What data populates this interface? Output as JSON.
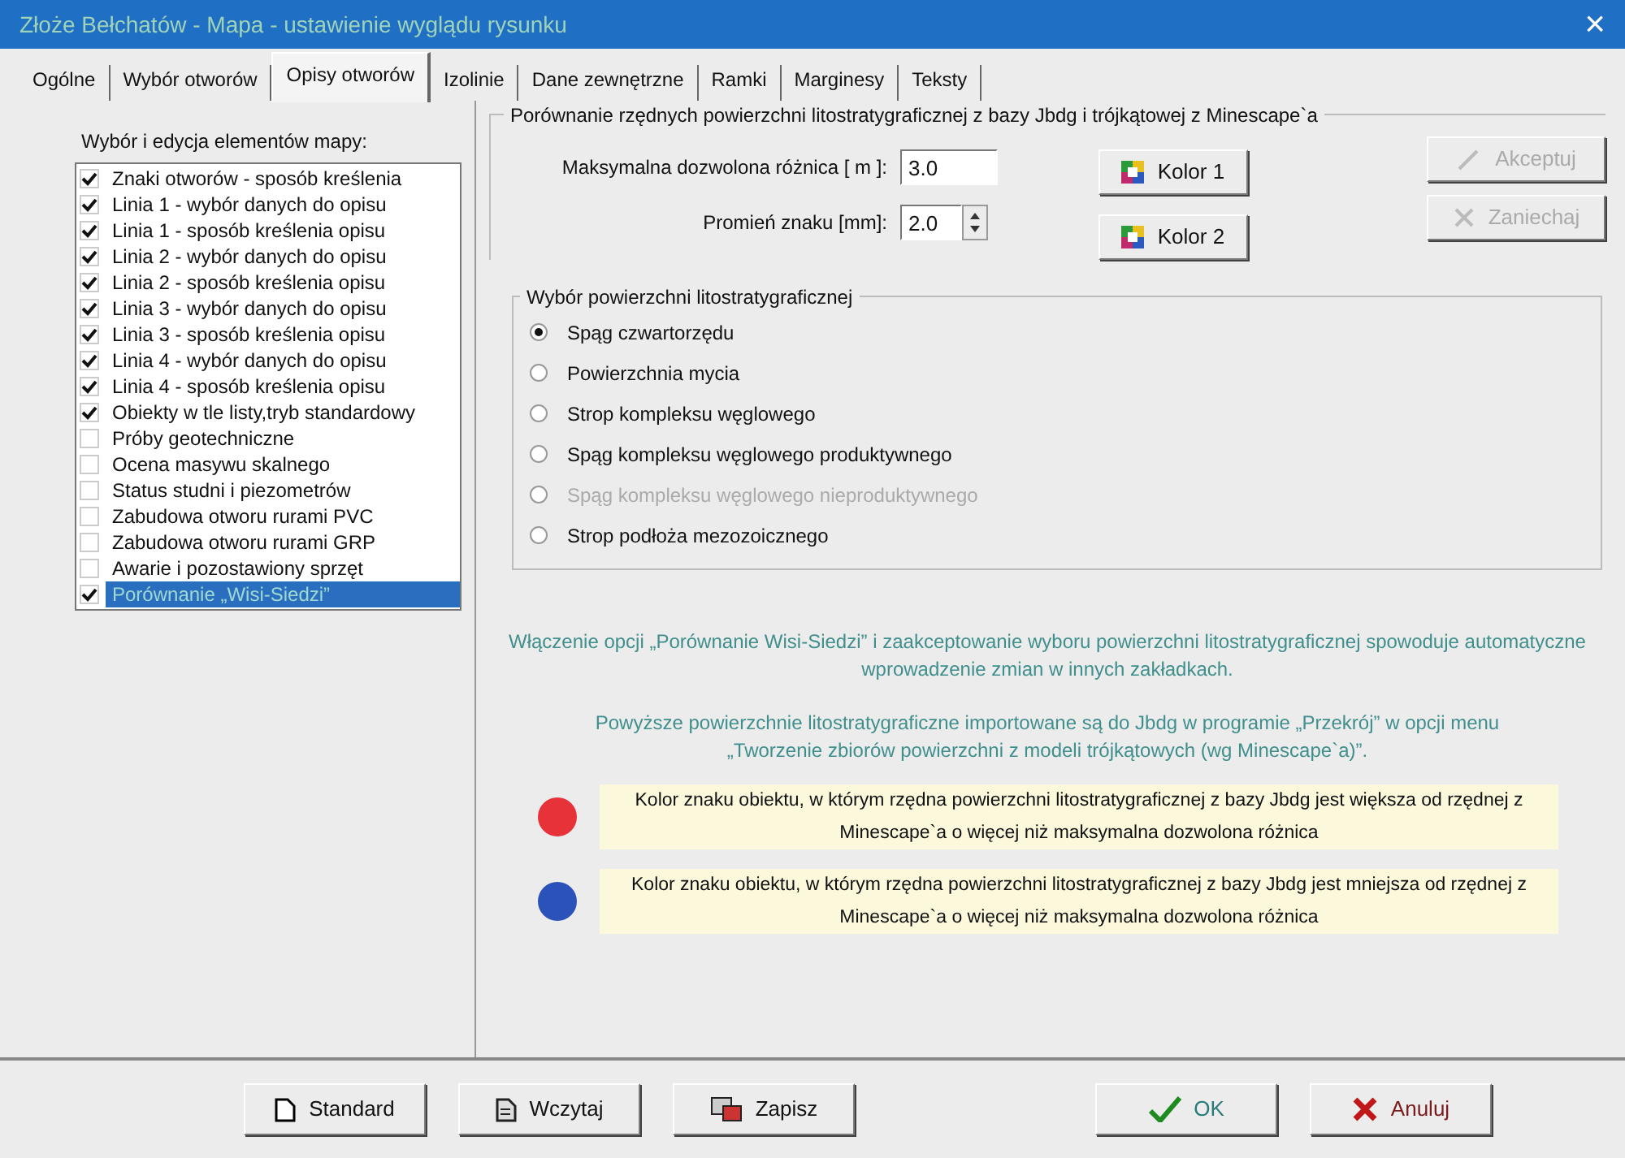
{
  "window": {
    "title": "Złoże Bełchatów - Mapa - ustawienie wyglądu rysunku",
    "close": "×"
  },
  "tabs": [
    {
      "label": "Ogólne",
      "selected": false
    },
    {
      "label": "Wybór otworów",
      "selected": false
    },
    {
      "label": "Opisy otworów",
      "selected": true
    },
    {
      "label": "Izolinie",
      "selected": false
    },
    {
      "label": "Dane zewnętrzne",
      "selected": false
    },
    {
      "label": "Ramki",
      "selected": false
    },
    {
      "label": "Marginesy",
      "selected": false
    },
    {
      "label": "Teksty",
      "selected": false
    }
  ],
  "elements": {
    "title": "Wybór i edycja elementów mapy:",
    "items": [
      {
        "label": "Znaki otworów - sposób kreślenia",
        "checked": true,
        "selected": false
      },
      {
        "label": "Linia 1 - wybór danych do opisu",
        "checked": true,
        "selected": false
      },
      {
        "label": "Linia 1 - sposób kreślenia opisu",
        "checked": true,
        "selected": false
      },
      {
        "label": "Linia 2 - wybór danych do opisu",
        "checked": true,
        "selected": false
      },
      {
        "label": "Linia 2 - sposób kreślenia opisu",
        "checked": true,
        "selected": false
      },
      {
        "label": "Linia 3 - wybór danych do opisu",
        "checked": true,
        "selected": false
      },
      {
        "label": "Linia 3 - sposób kreślenia opisu",
        "checked": true,
        "selected": false
      },
      {
        "label": "Linia 4 - wybór danych do opisu",
        "checked": true,
        "selected": false
      },
      {
        "label": "Linia 4 - sposób kreślenia opisu",
        "checked": true,
        "selected": false
      },
      {
        "label": "Obiekty w tle listy,tryb standardowy",
        "checked": true,
        "selected": false
      },
      {
        "label": "Próby geotechniczne",
        "checked": false,
        "selected": false
      },
      {
        "label": "Ocena masywu skalnego",
        "checked": false,
        "selected": false
      },
      {
        "label": "Status studni i piezometrów",
        "checked": false,
        "selected": false
      },
      {
        "label": "Zabudowa otworu rurami PVC",
        "checked": false,
        "selected": false
      },
      {
        "label": "Zabudowa otworu rurami GRP",
        "checked": false,
        "selected": false
      },
      {
        "label": "Awarie i pozostawiony sprzęt",
        "checked": false,
        "selected": false
      },
      {
        "label": "Porównanie „Wisi-Siedzi”",
        "checked": true,
        "selected": true
      }
    ]
  },
  "comparison": {
    "title": "Porównanie rzędnych powierzchni litostratygraficznej z bazy Jbdg i trójkątowej z Minescape`a",
    "max_diff": {
      "label": "Maksymalna dozwolona różnica [ m ]:",
      "value": "3.0"
    },
    "radius": {
      "label": "Promień znaku [mm]:",
      "value": "2.0"
    },
    "color_buttons": [
      "Kolor 1",
      "Kolor 2"
    ],
    "actions": [
      {
        "label": "Akceptuj",
        "disabled": true
      },
      {
        "label": "Zaniechaj",
        "disabled": true
      }
    ],
    "surface": {
      "title": "Wybór powierzchni litostratygraficznej",
      "options": [
        {
          "label": "Spąg czwartorzędu",
          "selected": true,
          "disabled": false
        },
        {
          "label": "Powierzchnia mycia",
          "selected": false,
          "disabled": false
        },
        {
          "label": "Strop kompleksu węglowego",
          "selected": false,
          "disabled": false
        },
        {
          "label": "Spąg kompleksu węglowego produktywnego",
          "selected": false,
          "disabled": false
        },
        {
          "label": "Spąg kompleksu węglowego nieproduktywnego",
          "selected": false,
          "disabled": true
        },
        {
          "label": "Strop podłoża mezozoicznego",
          "selected": false,
          "disabled": false
        }
      ]
    },
    "notes": [
      "Włączenie opcji „Porównanie Wisi-Siedzi” i zaakceptowanie wyboru powierzchni litostratygraficznej spowoduje automatyczne wprowadzenie zmian w innych zakładkach.",
      "Powyższe powierzchnie litostratygraficzne importowane są do Jbdg w programie „Przekrój” w opcji menu „Tworzenie zbiorów powierzchni z modeli trójkątowych (wg Minescape`a)”."
    ],
    "legend": [
      {
        "color": "#e8323a",
        "text": "Kolor znaku obiektu, w którym rzędna powierzchni litostratygraficznej z bazy Jbdg jest większa od rzędnej z Minescape`a o więcej niż maksymalna dozwolona różnica"
      },
      {
        "color": "#2a52b8",
        "text": "Kolor znaku obiektu, w którym rzędna powierzchni litostratygraficznej z bazy Jbdg jest mniejsza od rzędnej z Minescape`a o więcej niż maksymalna dozwolona różnica"
      }
    ]
  },
  "footer": [
    {
      "label": "Standard",
      "kind": "page"
    },
    {
      "label": "Wczytaj",
      "kind": "load"
    },
    {
      "label": "Zapisz",
      "kind": "save"
    },
    {
      "label": "OK",
      "kind": "ok"
    },
    {
      "label": "Anuluj",
      "kind": "cancel"
    }
  ]
}
